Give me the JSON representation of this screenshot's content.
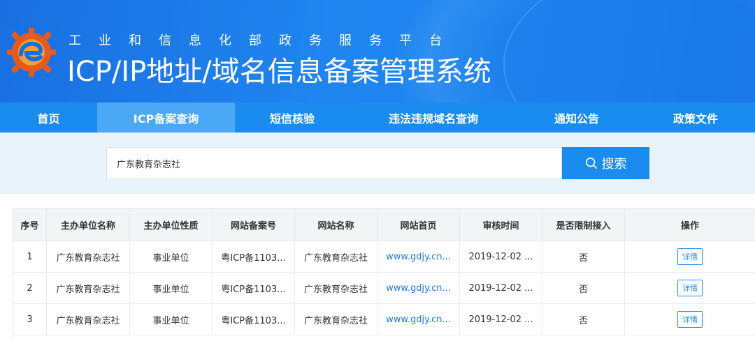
{
  "header": {
    "subtitle": "工业和信息化部政务服务平台",
    "title": "ICP/IP地址/域名信息备案管理系统"
  },
  "nav": {
    "items": [
      {
        "label": "首页"
      },
      {
        "label": "ICP备案查询"
      },
      {
        "label": "短信核验"
      },
      {
        "label": "违法违规域名查询"
      },
      {
        "label": "通知公告"
      },
      {
        "label": "政策文件"
      }
    ]
  },
  "search": {
    "value": "广东教育杂志社",
    "button_label": "搜索"
  },
  "table": {
    "headers": [
      "序号",
      "主办单位名称",
      "主办单位性质",
      "网站备案号",
      "网站名称",
      "网站首页",
      "审核时间",
      "是否限制接入",
      "操作"
    ],
    "rows": [
      {
        "index": "1",
        "org": "广东教育杂志社",
        "nature": "事业单位",
        "icp": "粤ICP备1103...",
        "site": "广东教育杂志社",
        "home": "www.gdjy.cn...",
        "time": "2019-12-02 ...",
        "limited": "否",
        "action": "详情"
      },
      {
        "index": "2",
        "org": "广东教育杂志社",
        "nature": "事业单位",
        "icp": "粤ICP备1103...",
        "site": "广东教育杂志社",
        "home": "www.gdjy.cn...",
        "time": "2019-12-02 ...",
        "limited": "否",
        "action": "详情"
      },
      {
        "index": "3",
        "org": "广东教育杂志社",
        "nature": "事业单位",
        "icp": "粤ICP备1103...",
        "site": "广东教育杂志社",
        "home": "www.gdjy.cn...",
        "time": "2019-12-02 ...",
        "limited": "否",
        "action": "详情"
      }
    ]
  },
  "colors": {
    "brand_blue": "#1a8cf0",
    "nav_active": "#4aa8f5",
    "search_bg": "#e8f3fc",
    "link": "#1a7ae0"
  }
}
